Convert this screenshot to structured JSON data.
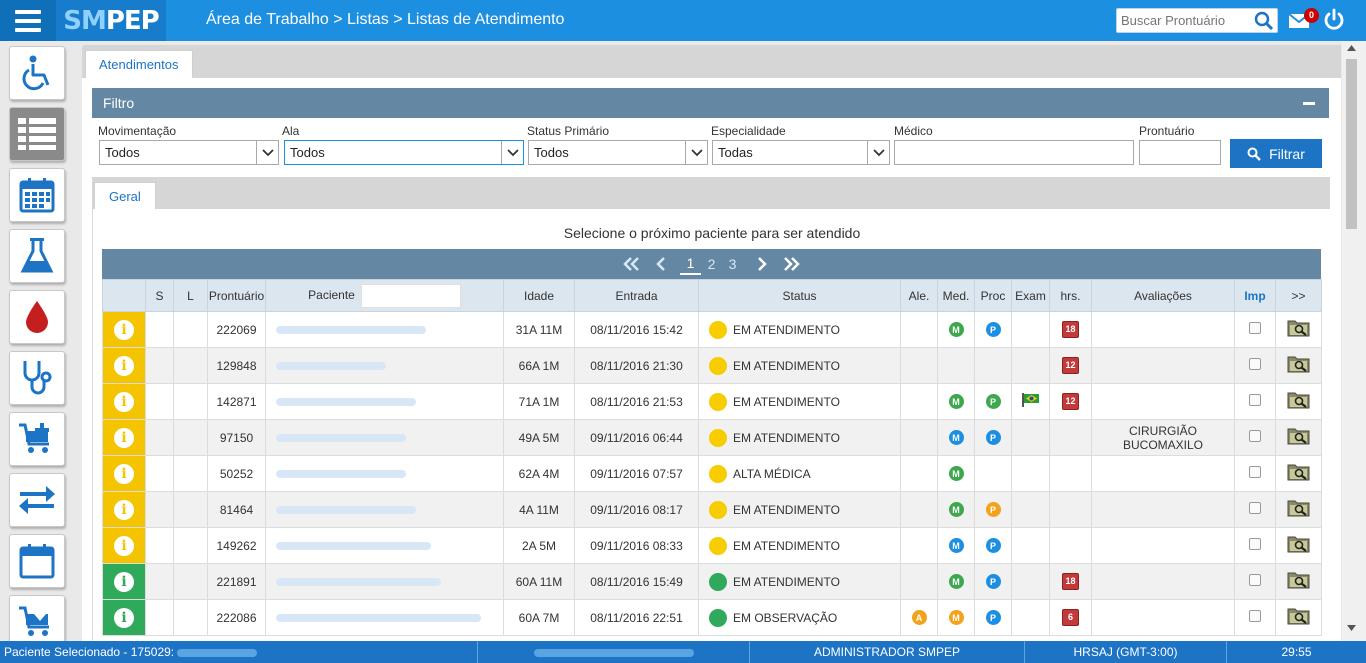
{
  "app": {
    "logo_sm": "SM",
    "logo_pep": "PEP"
  },
  "header": {
    "breadcrumb": "Área de Trabalho > Listas > Listas de Atendimento",
    "search_placeholder": "Buscar Prontuário",
    "mail_count": "0"
  },
  "sidebar": {
    "items": [
      "wheelchair-icon",
      "list-icon",
      "calendar-icon",
      "flask-icon",
      "blood-drop-icon",
      "stethoscope-icon",
      "cart-add-icon",
      "transfer-arrows-icon",
      "calendar-blank-icon",
      "cart-download-icon"
    ],
    "active_index": 1
  },
  "tabs": {
    "main": "Atendimentos",
    "inner": "Geral"
  },
  "filter": {
    "title": "Filtro",
    "fields": {
      "movimentacao_label": "Movimentação",
      "movimentacao_value": "Todos",
      "ala_label": "Ala",
      "ala_value": "Todos",
      "status_label": "Status Primário",
      "status_value": "Todos",
      "especialidade_label": "Especialidade",
      "especialidade_value": "Todas",
      "medico_label": "Médico",
      "medico_value": "",
      "prontuario_label": "Prontuário",
      "prontuario_value": ""
    },
    "button": "Filtrar"
  },
  "list": {
    "instruction": "Selecione o próximo paciente para ser atendido",
    "pages": [
      "1",
      "2",
      "3"
    ],
    "current_page": "1",
    "columns": {
      "s": "S",
      "l": "L",
      "prontuario": "Prontuário",
      "paciente": "Paciente",
      "idade": "Idade",
      "entrada": "Entrada",
      "status": "Status",
      "ale": "Ale.",
      "med": "Med.",
      "proc": "Proc",
      "exam": "Exam",
      "hrs": "hrs.",
      "avaliacoes": "Avaliações",
      "imp": "Imp",
      "more": ">>"
    },
    "rows": [
      {
        "color": "yellow",
        "prontuario": "222069",
        "idade": "31A 11M",
        "entrada": "08/11/2016 15:42",
        "status": "EM ATENDIMENTO",
        "status_color": "#f7cd00",
        "ale": "",
        "med": "M",
        "med_color": "green",
        "proc": "P",
        "proc_color": "blue",
        "exam": false,
        "hrs": "18",
        "avaliacao": ""
      },
      {
        "color": "yellow",
        "prontuario": "129848",
        "idade": "66A 1M",
        "entrada": "08/11/2016 21:30",
        "status": "EM ATENDIMENTO",
        "status_color": "#f7cd00",
        "ale": "",
        "med": "",
        "med_color": "",
        "proc": "",
        "proc_color": "",
        "exam": false,
        "hrs": "12",
        "avaliacao": ""
      },
      {
        "color": "yellow",
        "prontuario": "142871",
        "idade": "71A 1M",
        "entrada": "08/11/2016 21:53",
        "status": "EM ATENDIMENTO",
        "status_color": "#f7cd00",
        "ale": "",
        "med": "M",
        "med_color": "green",
        "proc": "P",
        "proc_color": "green",
        "exam": true,
        "hrs": "12",
        "avaliacao": ""
      },
      {
        "color": "yellow",
        "prontuario": "97150",
        "idade": "49A 5M",
        "entrada": "09/11/2016 06:44",
        "status": "EM ATENDIMENTO",
        "status_color": "#f7cd00",
        "ale": "",
        "med": "M",
        "med_color": "blue",
        "proc": "P",
        "proc_color": "blue",
        "exam": false,
        "hrs": "",
        "avaliacao": "CIRURGIÃO BUCOMAXILO"
      },
      {
        "color": "yellow",
        "prontuario": "50252",
        "idade": "62A 4M",
        "entrada": "09/11/2016 07:57",
        "status": "ALTA MÉDICA",
        "status_color": "#f7cd00",
        "ale": "",
        "med": "M",
        "med_color": "green",
        "proc": "",
        "proc_color": "",
        "exam": false,
        "hrs": "",
        "avaliacao": ""
      },
      {
        "color": "yellow",
        "prontuario": "81464",
        "idade": "4A 11M",
        "entrada": "09/11/2016 08:17",
        "status": "EM ATENDIMENTO",
        "status_color": "#f7cd00",
        "ale": "",
        "med": "M",
        "med_color": "green",
        "proc": "P",
        "proc_color": "orange",
        "exam": false,
        "hrs": "",
        "avaliacao": ""
      },
      {
        "color": "yellow",
        "prontuario": "149262",
        "idade": "2A 5M",
        "entrada": "09/11/2016 08:33",
        "status": "EM ATENDIMENTO",
        "status_color": "#f7cd00",
        "ale": "",
        "med": "M",
        "med_color": "blue",
        "proc": "P",
        "proc_color": "blue",
        "exam": false,
        "hrs": "",
        "avaliacao": ""
      },
      {
        "color": "green",
        "prontuario": "221891",
        "idade": "60A 11M",
        "entrada": "08/11/2016 15:49",
        "status": "EM ATENDIMENTO",
        "status_color": "#2faa5a",
        "ale": "",
        "med": "M",
        "med_color": "green",
        "proc": "P",
        "proc_color": "blue",
        "exam": false,
        "hrs": "18",
        "avaliacao": ""
      },
      {
        "color": "green",
        "prontuario": "222086",
        "idade": "60A 7M",
        "entrada": "08/11/2016 22:51",
        "status": "EM OBSERVAÇÃO",
        "status_color": "#2faa5a",
        "ale": "A",
        "med": "M",
        "med_color": "orange",
        "proc": "P",
        "proc_color": "blue",
        "exam": false,
        "hrs": "6",
        "avaliacao": ""
      }
    ]
  },
  "statusbar": {
    "selected": "Paciente Selecionado - 175029:",
    "user": "ADMINISTRADOR SMPEP",
    "unit": "HRSAJ (GMT-3:00)",
    "timer": "29:55"
  },
  "colors": {
    "primary": "#1d8fe0",
    "header_bar": "#6487a3",
    "button": "#1d74c5"
  }
}
